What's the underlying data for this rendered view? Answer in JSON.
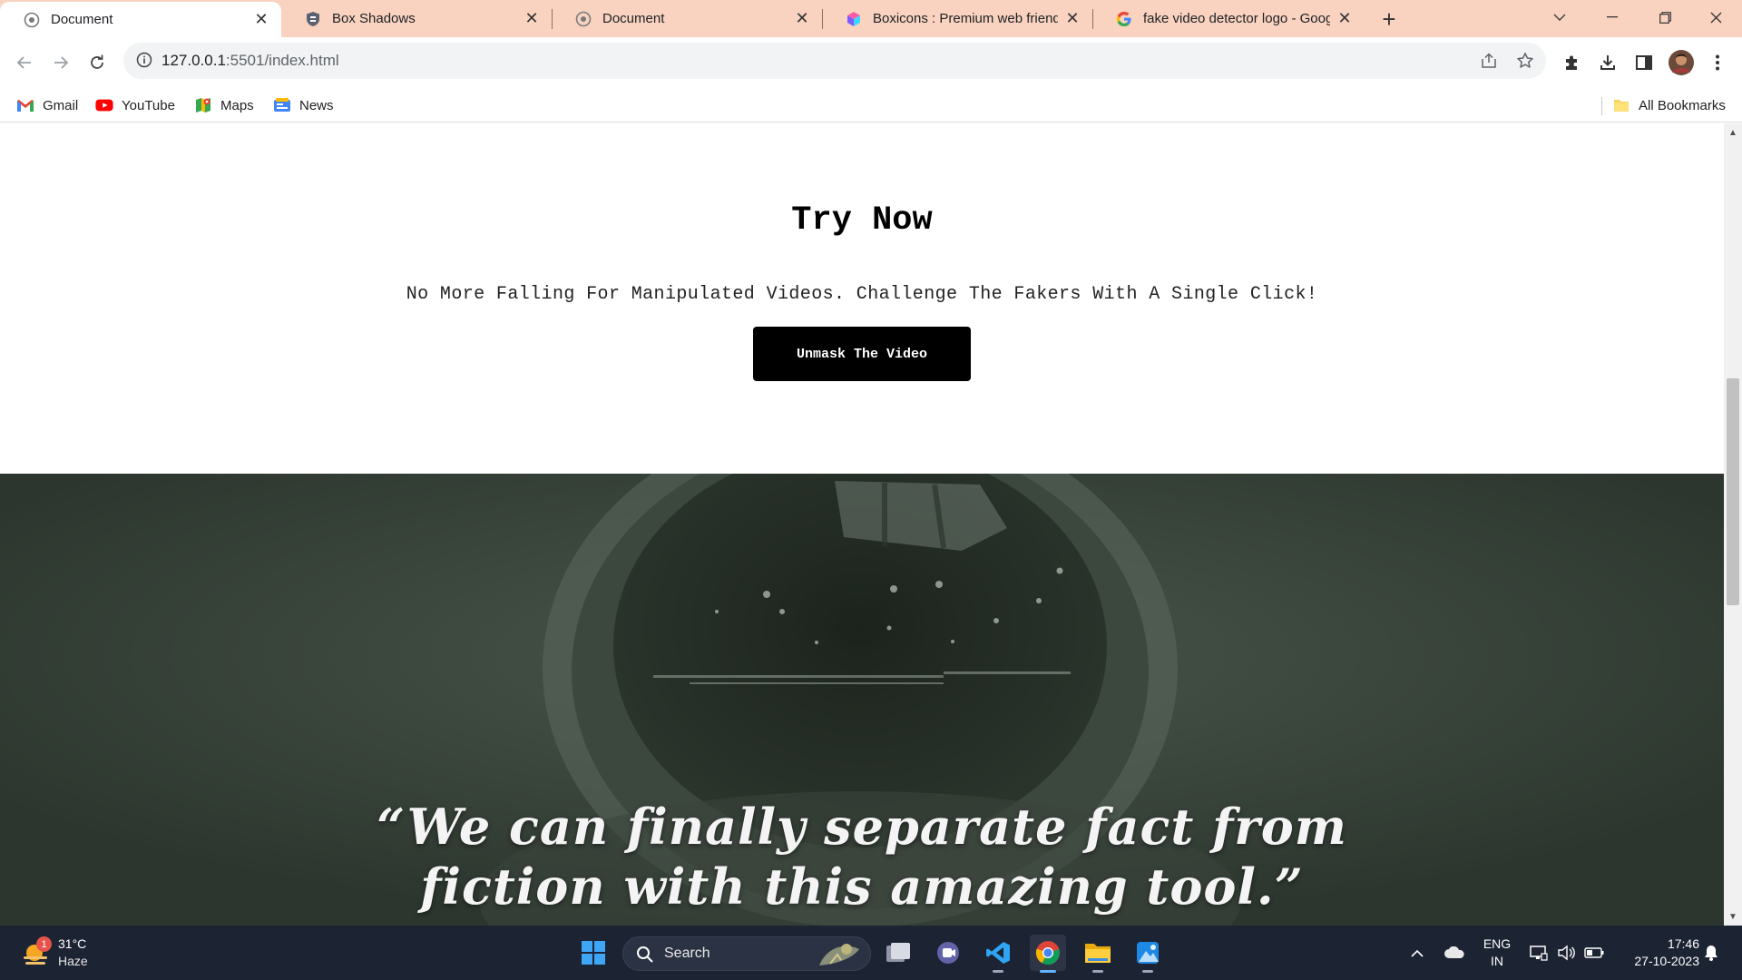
{
  "browser": {
    "tabs": [
      {
        "title": "Document",
        "favicon": "globe-icon",
        "active": true
      },
      {
        "title": "Box Shadows",
        "favicon": "shield-icon",
        "active": false
      },
      {
        "title": "Document",
        "favicon": "globe-icon",
        "active": false
      },
      {
        "title": "Boxicons : Premium web friendly",
        "favicon": "boxicons-logo-icon",
        "active": false
      },
      {
        "title": "fake video detector logo - Goog",
        "favicon": "google-g-icon",
        "active": false
      }
    ],
    "address": {
      "host": "127.0.0.1",
      "path": ":5501/index.html"
    },
    "bookmarks": [
      {
        "label": "Gmail",
        "icon": "gmail-icon"
      },
      {
        "label": "YouTube",
        "icon": "youtube-icon"
      },
      {
        "label": "Maps",
        "icon": "maps-icon"
      },
      {
        "label": "News",
        "icon": "news-icon"
      }
    ],
    "all_bookmarks_label": "All Bookmarks"
  },
  "page": {
    "try_title": "Try Now",
    "try_subtitle": "No More Falling For Manipulated Videos. Challenge The Fakers With A Single Click!",
    "cta_label": "Unmask The Video",
    "quote_line1": "“We can finally separate fact from",
    "quote_line2": "fiction with this amazing tool.”",
    "hero_bg_color": "#2f3a31"
  },
  "taskbar": {
    "weather_temp": "31°C",
    "weather_condition": "Haze",
    "weather_badge": "1",
    "search_label": "Search",
    "lang_line1": "ENG",
    "lang_line2": "IN",
    "time": "17:46",
    "date": "27-10-2023"
  },
  "colors": {
    "tabstrip": "#f9d3c0",
    "taskbar": "#1c2333",
    "cta_bg": "#000000"
  }
}
